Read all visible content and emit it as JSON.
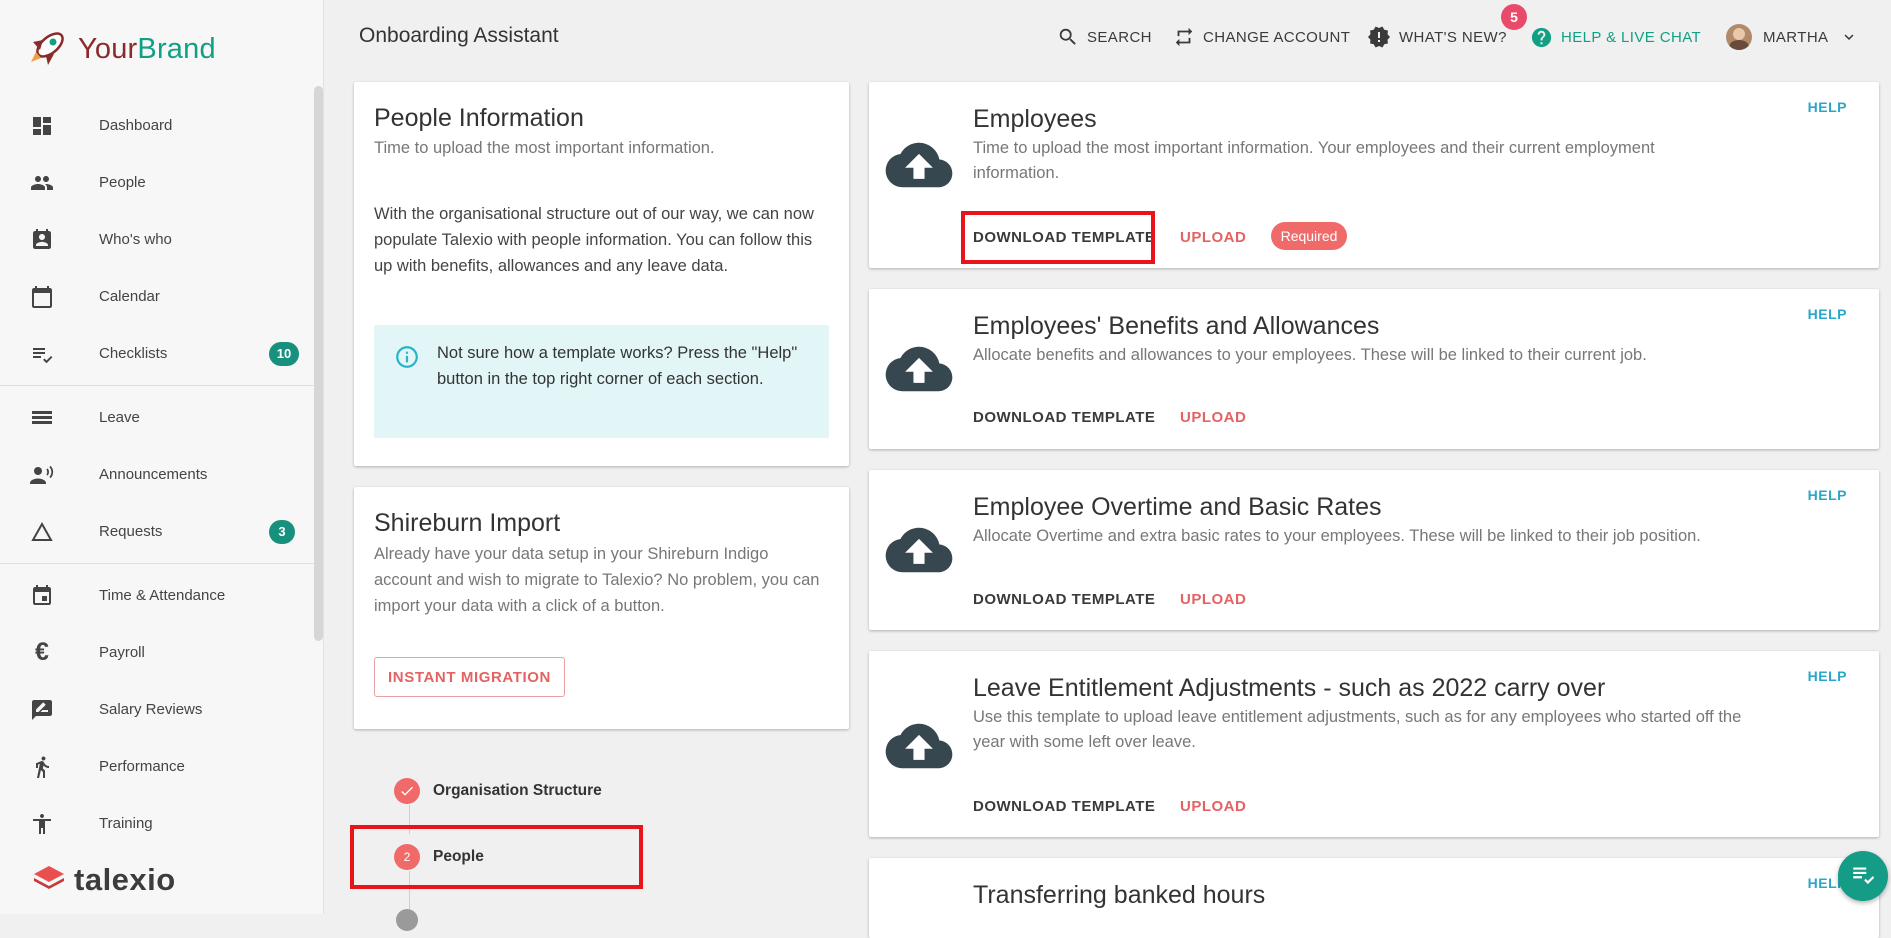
{
  "brand": {
    "name_part1": "Your",
    "name_part2": "Brand",
    "footer_logo": "talexio"
  },
  "sidebar": {
    "items": [
      {
        "label": "Dashboard",
        "icon": "dashboard-icon"
      },
      {
        "label": "People",
        "icon": "people-icon"
      },
      {
        "label": "Who's who",
        "icon": "contact-badge-icon"
      },
      {
        "label": "Calendar",
        "icon": "calendar-icon"
      },
      {
        "label": "Checklists",
        "icon": "checklist-icon",
        "count": "10"
      },
      {
        "label": "Leave",
        "icon": "leave-icon"
      },
      {
        "label": "Announcements",
        "icon": "announcement-icon"
      },
      {
        "label": "Requests",
        "icon": "triangle-icon",
        "count": "3"
      },
      {
        "label": "Time & Attendance",
        "icon": "event-icon"
      },
      {
        "label": "Payroll",
        "icon": "euro-icon"
      },
      {
        "label": "Salary Reviews",
        "icon": "rate-review-icon"
      },
      {
        "label": "Performance",
        "icon": "run-icon"
      },
      {
        "label": "Training",
        "icon": "accessibility-icon"
      }
    ]
  },
  "header": {
    "title": "Onboarding Assistant",
    "search": "SEARCH",
    "change_account": "CHANGE ACCOUNT",
    "whats_new": "WHAT'S NEW?",
    "whats_new_count": "5",
    "help_chat": "HELP & LIVE CHAT",
    "user": "MARTHA"
  },
  "people_info": {
    "title": "People Information",
    "subtitle": "Time to upload the most important information.",
    "body": "With the organisational structure out of our way, we can now populate Talexio with people information. You can follow this up with benefits, allowances and any leave data.",
    "info": "Not sure how a template works? Press the \"Help\" button in the top right corner of each section."
  },
  "shireburn": {
    "title": "Shireburn Import",
    "body": "Already have your data setup in your Shireburn Indigo account and wish to migrate to Talexio? No problem, you can import your data with a click of a button.",
    "button": "INSTANT MIGRATION"
  },
  "steps": [
    {
      "label": "Organisation Structure",
      "status": "done"
    },
    {
      "number": "2",
      "label": "People",
      "status": "current"
    }
  ],
  "labels": {
    "help": "HELP",
    "download": "DOWNLOAD TEMPLATE",
    "upload": "UPLOAD",
    "required": "Required"
  },
  "uploads": [
    {
      "title": "Employees",
      "desc": "Time to upload the most important information. Your employees and their current employment information.",
      "required": true
    },
    {
      "title": "Employees' Benefits and Allowances",
      "desc": "Allocate benefits and allowances to your employees. These will be linked to their current job."
    },
    {
      "title": "Employee Overtime and Basic Rates",
      "desc": "Allocate Overtime and extra basic rates to your employees. These will be linked to their job position."
    },
    {
      "title": "Leave Entitlement Adjustments - such as 2022 carry over",
      "desc": "Use this template to upload leave entitlement adjustments, such as for any employees who started off the year with some left over leave."
    },
    {
      "title": "Transferring banked hours"
    }
  ],
  "colors": {
    "accent": "#17907d",
    "upload_red": "#e36363",
    "help_blue": "#2aa7c7",
    "highlight": "#e8141a"
  }
}
